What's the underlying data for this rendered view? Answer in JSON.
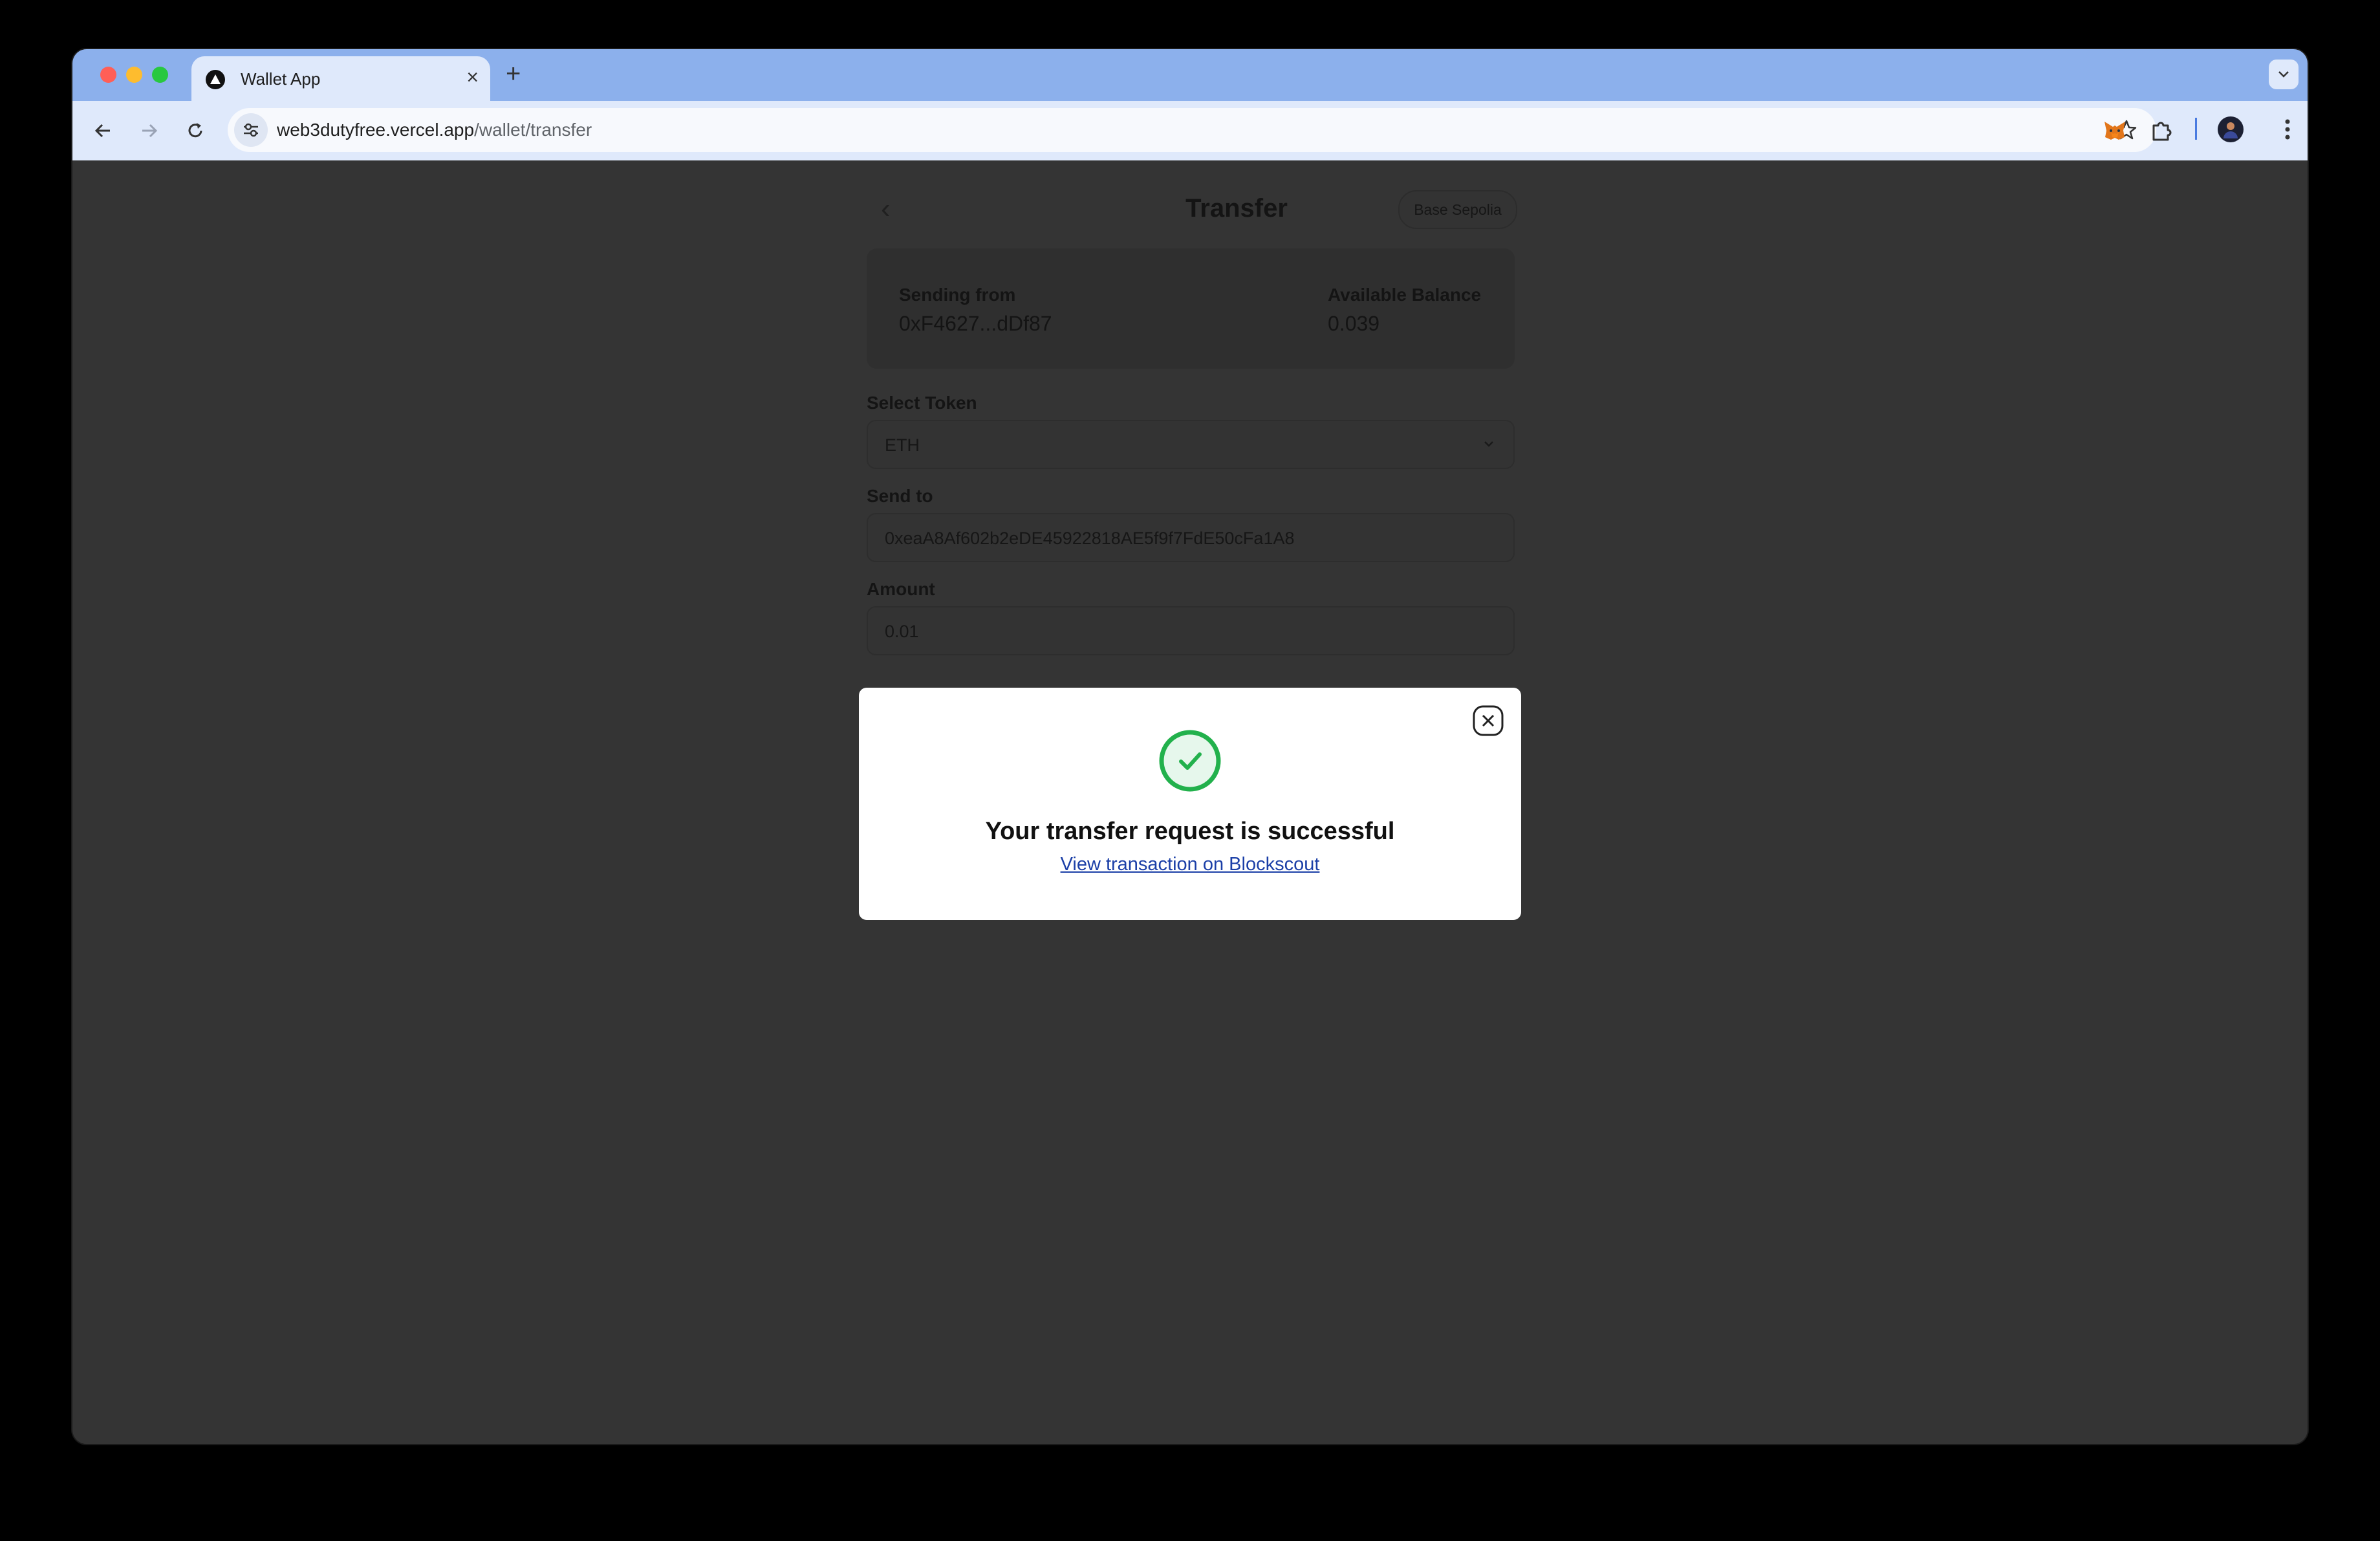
{
  "browser": {
    "tab": {
      "title": "Wallet App",
      "close_glyph": "×"
    },
    "new_tab_glyph": "+",
    "address_bar": {
      "host": "web3dutyfree.vercel.app",
      "path": "/wallet/transfer"
    },
    "icons": [
      "back-arrow-icon",
      "forward-arrow-icon",
      "reload-icon",
      "site-info-icon",
      "bookmark-star-icon",
      "metamask-fox-icon",
      "extensions-puzzle-icon",
      "profile-avatar-icon",
      "more-menu-icon",
      "tab-search-chevron-icon"
    ]
  },
  "page": {
    "back_glyph": "‹",
    "title": "Transfer",
    "network": "Base Sepolia",
    "sending_from": {
      "label": "Sending from",
      "value": "0xF4627...dDf87"
    },
    "balance": {
      "label": "Available Balance",
      "value": "0.039"
    },
    "select_token": {
      "label": "Select Token",
      "value": "ETH"
    },
    "send_to": {
      "label": "Send to",
      "value": "0xeaA8Af602b2eDE45922818AE5f9f7FdE50cFa1A8"
    },
    "amount": {
      "label": "Amount",
      "value": "0.01"
    }
  },
  "modal": {
    "message": "Your transfer request is successful",
    "link_text": "View transaction on Blockscout"
  },
  "colors": {
    "tab_strip": "#8cb0ec",
    "toolbar": "#dfe9fb",
    "page_overlay": "#343434",
    "success_green": "#22b14c",
    "link_blue": "#1b3fa7"
  }
}
